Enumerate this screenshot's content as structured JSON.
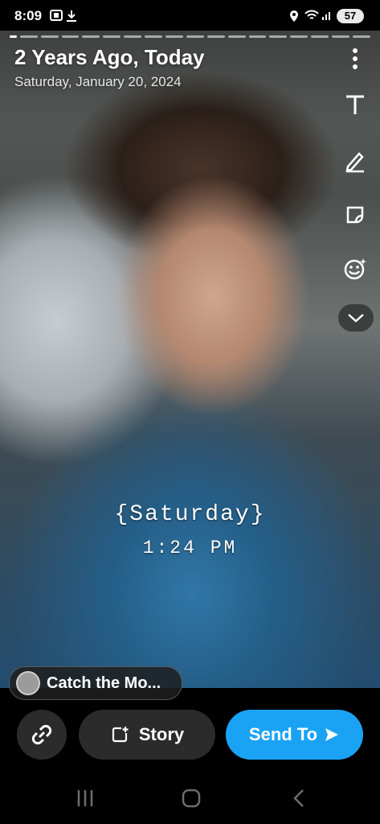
{
  "status_bar": {
    "time": "8:09",
    "battery": "57"
  },
  "memory": {
    "title": "2 Years Ago, Today",
    "date": "Saturday, January 20, 2024"
  },
  "caption": {
    "line1": "{Saturday}",
    "line2": "1:24 PM"
  },
  "chip": {
    "label": "Catch the Mo..."
  },
  "actions": {
    "story_label": "Story",
    "send_label": "Send To"
  },
  "colors": {
    "send_button": "#1aa3f4",
    "dark_button": "#2b2b2b"
  },
  "icons": [
    "screenshot-icon",
    "download-icon",
    "location-icon",
    "wifi-icon",
    "signal-icon",
    "more-options-icon",
    "text-tool-icon",
    "pencil-icon",
    "sticker-icon",
    "emoji-icon",
    "chevron-down-icon",
    "link-icon",
    "add-story-icon",
    "send-arrow-icon",
    "recents-icon",
    "home-icon",
    "back-icon"
  ]
}
